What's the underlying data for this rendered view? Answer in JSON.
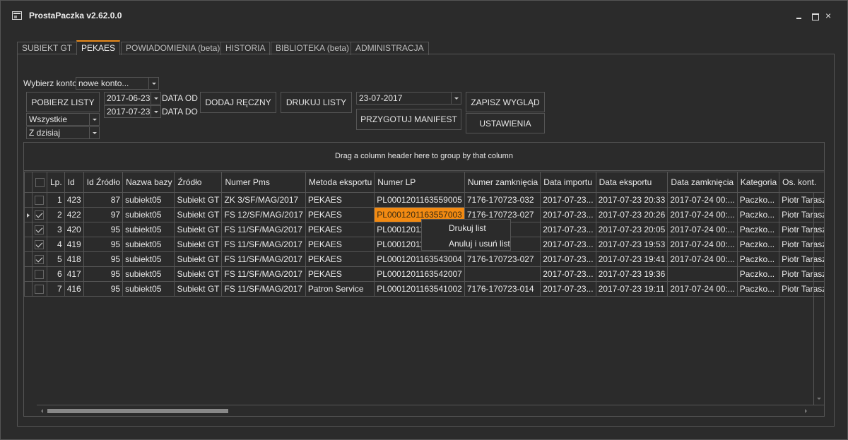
{
  "window": {
    "title": "ProstaPaczka v2.62.0.0"
  },
  "tabs": [
    "SUBIEKT GT",
    "PEKAES",
    "POWIADOMIENIA (beta)",
    "HISTORIA",
    "BIBLIOTEKA (beta)",
    "ADMINISTRACJA"
  ],
  "active_tab": "PEKAES",
  "toolbar": {
    "account_label": "Wybierz konto:",
    "account_value": "nowe konto...",
    "fetch_button": "POBIERZ LISTY",
    "filter_value": "Wszystkie",
    "range_value": "Z dzisiaj",
    "date_from": "2017-06-23",
    "date_from_label": "DATA OD",
    "date_to": "2017-07-23",
    "date_to_label": "DATA DO",
    "add_manual_button": "DODAJ RĘCZNY",
    "print_lists_button": "DRUKUJ LISTY",
    "manifest_date": "23-07-2017",
    "manifest_button": "PRZYGOTUJ MANIFEST",
    "save_layout_button": "ZAPISZ WYGLĄD",
    "settings_button": "USTAWIENIA"
  },
  "grid": {
    "group_hint": "Drag a column header here to group by that column",
    "columns": [
      "Lp.",
      "Id",
      "Id Źródło",
      "Nazwa bazy",
      "Źródło",
      "Numer Pms",
      "Metoda eksportu",
      "Numer LP",
      "Numer zamknięcia",
      "Data importu",
      "Data eksportu",
      "Data zamknięcia",
      "Kategoria",
      "Os. kont."
    ],
    "rows": [
      {
        "checked": false,
        "current": false,
        "lp": "1",
        "id": "423",
        "id_src": "87",
        "db": "subiekt05",
        "src": "Subiekt GT",
        "pms": "ZK 3/SF/MAG/2017",
        "method": "PEKAES",
        "lp_no": "PL0001201163559005",
        "close_no": "7176-170723-032",
        "imp": "2017-07-23...",
        "exp": "2017-07-23 20:33",
        "closed": "2017-07-24 00:...",
        "cat": "Paczko...",
        "person": "Piotr Taraszkiewicz"
      },
      {
        "checked": true,
        "current": true,
        "lp": "2",
        "id": "422",
        "id_src": "97",
        "db": "subiekt05",
        "src": "Subiekt GT",
        "pms": "FS 12/SF/MAG/2017",
        "method": "PEKAES",
        "lp_no": "PL0001201163557003",
        "close_no": "7176-170723-027",
        "imp": "2017-07-23...",
        "exp": "2017-07-23 20:26",
        "closed": "2017-07-24 00:...",
        "cat": "Paczko...",
        "person": "Piotr Taraszkiewicz"
      },
      {
        "checked": true,
        "current": false,
        "lp": "3",
        "id": "420",
        "id_src": "95",
        "db": "subiekt05",
        "src": "Subiekt GT",
        "pms": "FS 11/SF/MAG/2017",
        "method": "PEKAES",
        "lp_no": "PL0001201163",
        "close_no": "7",
        "imp": "2017-07-23...",
        "exp": "2017-07-23 20:05",
        "closed": "2017-07-24 00:...",
        "cat": "Paczko...",
        "person": "Piotr Taraszkiewicz"
      },
      {
        "checked": true,
        "current": false,
        "lp": "4",
        "id": "419",
        "id_src": "95",
        "db": "subiekt05",
        "src": "Subiekt GT",
        "pms": "FS 11/SF/MAG/2017",
        "method": "PEKAES",
        "lp_no": "PL0001201163",
        "close_no": "7",
        "imp": "2017-07-23...",
        "exp": "2017-07-23 19:53",
        "closed": "2017-07-24 00:...",
        "cat": "Paczko...",
        "person": "Piotr Taraszkiewicz"
      },
      {
        "checked": true,
        "current": false,
        "lp": "5",
        "id": "418",
        "id_src": "95",
        "db": "subiekt05",
        "src": "Subiekt GT",
        "pms": "FS 11/SF/MAG/2017",
        "method": "PEKAES",
        "lp_no": "PL0001201163543004",
        "close_no": "7176-170723-027",
        "imp": "2017-07-23...",
        "exp": "2017-07-23 19:41",
        "closed": "2017-07-24 00:...",
        "cat": "Paczko...",
        "person": "Piotr Taraszkiewicz"
      },
      {
        "checked": false,
        "current": false,
        "lp": "6",
        "id": "417",
        "id_src": "95",
        "db": "subiekt05",
        "src": "Subiekt GT",
        "pms": "FS 11/SF/MAG/2017",
        "method": "PEKAES",
        "lp_no": "PL0001201163542007",
        "close_no": "",
        "imp": "2017-07-23...",
        "exp": "2017-07-23 19:36",
        "closed": "",
        "cat": "Paczko...",
        "person": "Piotr Taraszkiewicz"
      },
      {
        "checked": false,
        "current": false,
        "lp": "7",
        "id": "416",
        "id_src": "95",
        "db": "subiekt05",
        "src": "Subiekt GT",
        "pms": "FS 11/SF/MAG/2017",
        "method": "Patron Service",
        "lp_no": "PL0001201163541002",
        "close_no": "7176-170723-014",
        "imp": "2017-07-23...",
        "exp": "2017-07-23 19:11",
        "closed": "2017-07-24 00:...",
        "cat": "Paczko...",
        "person": "Piotr Taraszkiewicz"
      }
    ],
    "highlight_color": "#f28a12"
  },
  "context_menu": {
    "items": [
      "Drukuj list",
      "Anuluj i usuń list"
    ]
  },
  "colors": {
    "background": "#2b2b2b",
    "accent": "#e88a1a",
    "border": "#555555"
  }
}
